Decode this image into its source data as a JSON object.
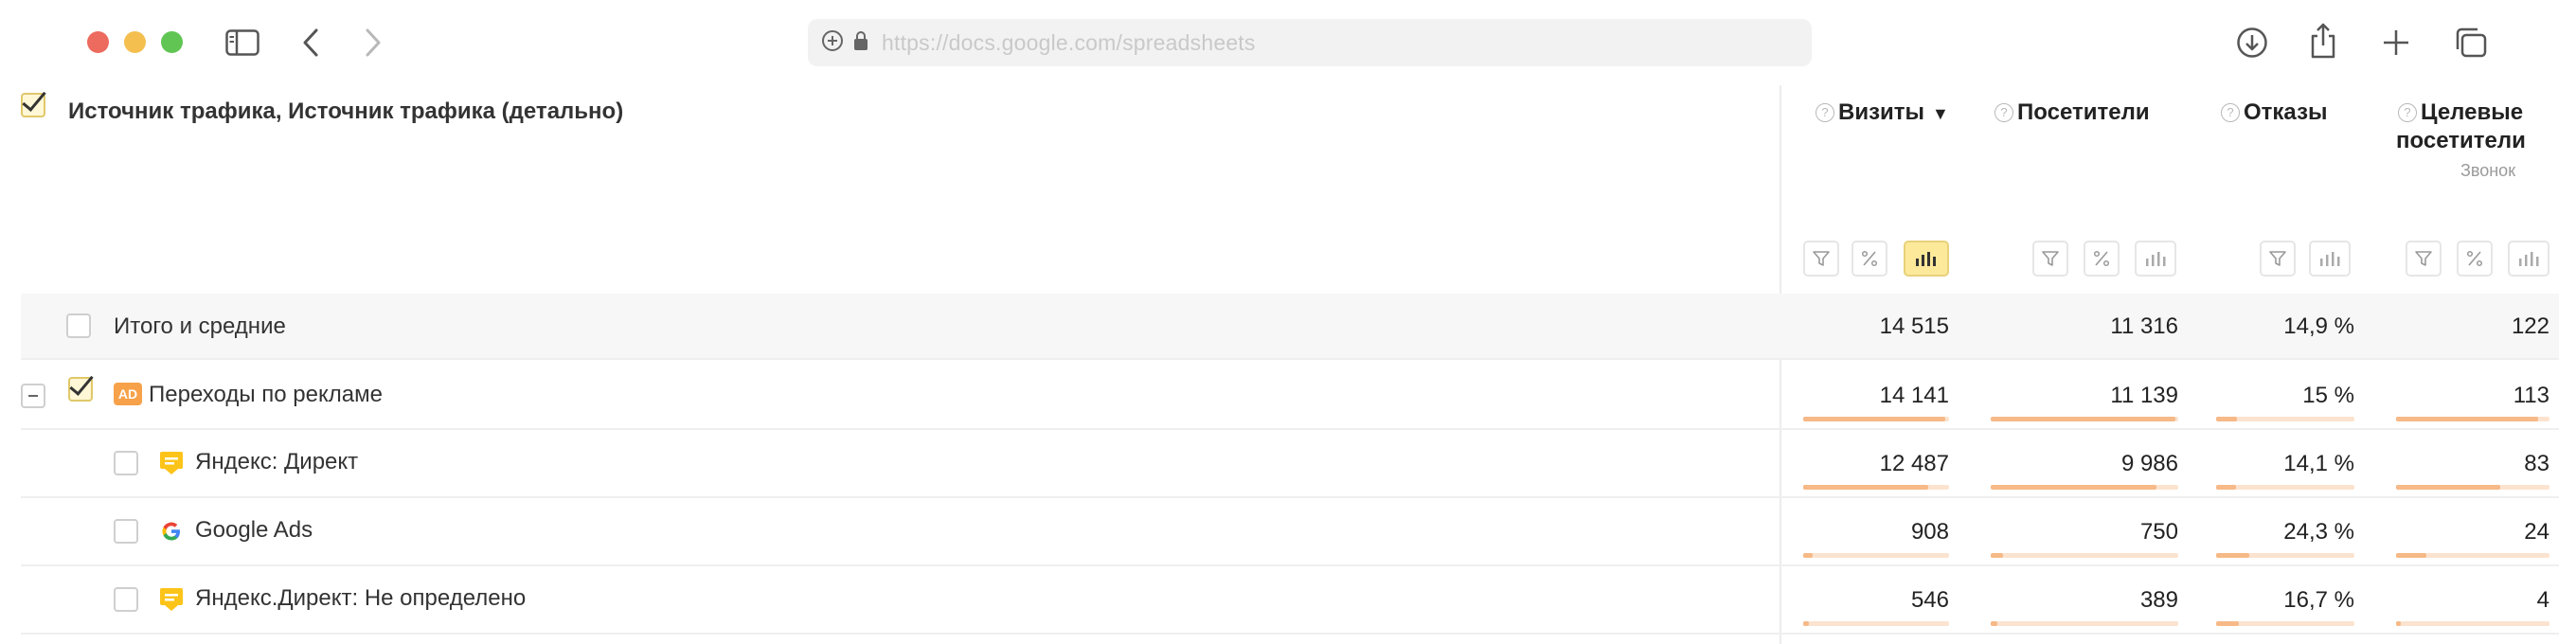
{
  "browser": {
    "url": "https://docs.google.com/spreadsheets",
    "icons": [
      "close-window-icon",
      "minimize-window-icon",
      "maximize-window-icon",
      "sidebar-icon",
      "back-icon",
      "forward-icon",
      "site-info-icon",
      "lock-icon",
      "download-icon",
      "share-icon",
      "new-tab-icon",
      "tabs-overview-icon"
    ]
  },
  "report": {
    "header_title": "Источник трафика, Источник трафика (детально)",
    "columns": [
      {
        "label": "Визиты",
        "sorted": true,
        "sort_arrow": "▼",
        "sub": ""
      },
      {
        "label": "Посетители",
        "sorted": false,
        "sub": ""
      },
      {
        "label": "Отказы",
        "sorted": false,
        "sub": ""
      },
      {
        "label_line1": "Целевые",
        "label_line2": "посетители",
        "sorted": false,
        "sub": "Звонок"
      }
    ],
    "rows": [
      {
        "label": "Итого и средние",
        "values": [
          "14 515",
          "11 316",
          "14,9 %",
          "122"
        ]
      },
      {
        "label": "Переходы по рекламе",
        "icon": "ad-badge-icon",
        "ad_badge": "AD",
        "values": [
          "14 141",
          "11 139",
          "15 %",
          "113"
        ],
        "bar_fractions": [
          0.974,
          0.984,
          0.15,
          0.926
        ]
      },
      {
        "label": "Яндекс: Директ",
        "icon": "yandex-direct-icon",
        "values": [
          "12 487",
          "9 986",
          "14,1 %",
          "83"
        ],
        "bar_fractions": [
          0.86,
          0.882,
          0.141,
          0.68
        ]
      },
      {
        "label": "Google Ads",
        "icon": "google-icon",
        "values": [
          "908",
          "750",
          "24,3 %",
          "24"
        ],
        "bar_fractions": [
          0.063,
          0.066,
          0.243,
          0.197
        ]
      },
      {
        "label": "Яндекс.Директ: Не определено",
        "icon": "yandex-direct-icon",
        "values": [
          "546",
          "389",
          "16,7 %",
          "4"
        ],
        "bar_fractions": [
          0.038,
          0.034,
          0.167,
          0.033
        ]
      }
    ]
  },
  "colors": {
    "bar_fill": "#f6b987",
    "bar_track": "#fbe3cf",
    "active_tool": "#fde99a",
    "yandex_direct": "#fcc419",
    "ad_badge": "#f7a24a"
  }
}
